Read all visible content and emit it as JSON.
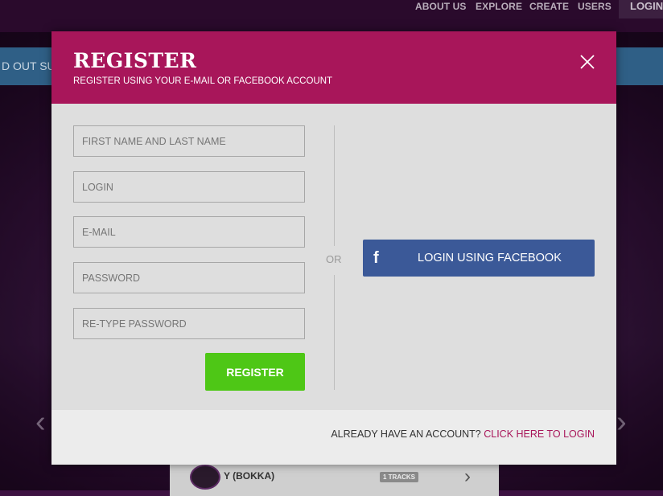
{
  "nav": {
    "links": [
      "ABOUT US",
      "EXPLORE",
      "CREATE",
      "USERS"
    ],
    "login": "LOGIN"
  },
  "banner": {
    "text": "D OUT SU"
  },
  "track": {
    "title": "Y (BOKKA)",
    "badge": "1 TRACKS"
  },
  "modal": {
    "title": "REGISTER",
    "subtitle": "REGISTER USING YOUR E-MAIL OR FACEBOOK ACCOUNT",
    "fields": {
      "name": {
        "placeholder": "FIRST NAME AND LAST NAME",
        "value": ""
      },
      "login": {
        "placeholder": "LOGIN",
        "value": ""
      },
      "email": {
        "placeholder": "E-MAIL",
        "value": ""
      },
      "password": {
        "placeholder": "PASSWORD",
        "value": ""
      },
      "retype": {
        "placeholder": "RE-TYPE PASSWORD",
        "value": ""
      }
    },
    "register_label": "REGISTER",
    "or": "OR",
    "facebook_label": "LOGIN USING FACEBOOK",
    "facebook_icon": "facebook-icon",
    "footer_text": "ALREADY HAVE AN ACCOUNT?",
    "footer_link": "CLICK HERE TO LOGIN"
  },
  "colors": {
    "header": "#a8165a",
    "register_button": "#4ec716",
    "facebook": "#3b5998",
    "link": "#a8165a"
  }
}
